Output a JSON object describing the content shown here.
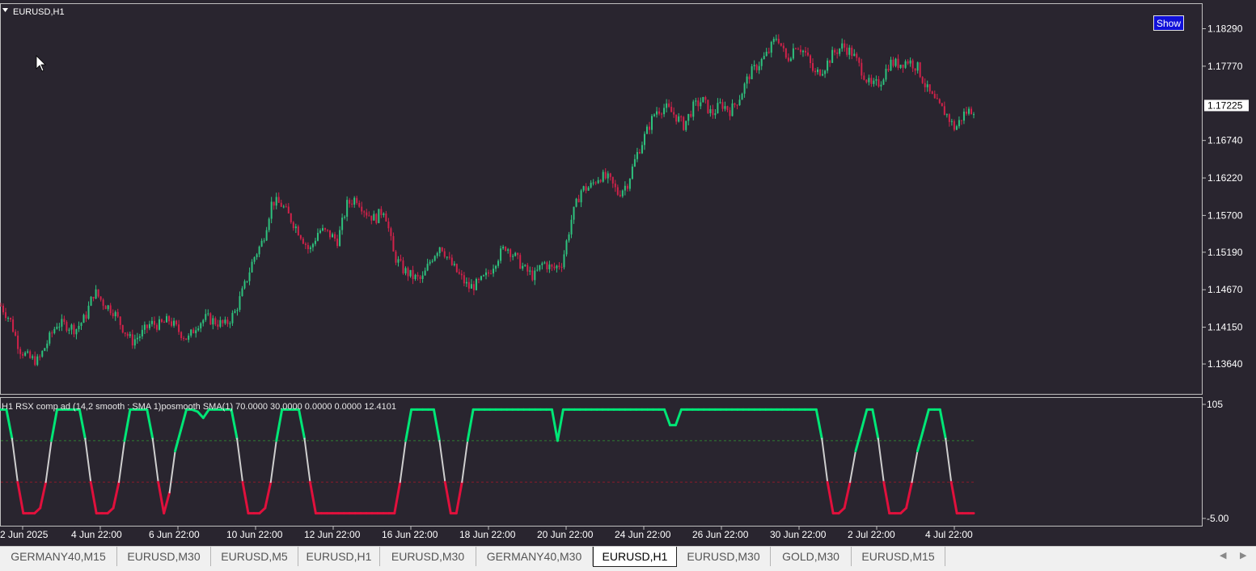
{
  "symbol_title": "EURUSD,H1",
  "indicator_title": "H1 RSX comp ad (14,2 smooth : SMA  1)posmooth SMA(1) 70.0000 30.0000 0.0000 0.0000 12.4101",
  "show_button": "Show",
  "current_price_label": "1.17225",
  "colors": {
    "background": "#29252f",
    "bull_candle": "#2ec27e",
    "bear_candle": "#d0224a",
    "indicator_up": "#00e676",
    "indicator_neutral": "#cfcfcf",
    "indicator_down": "#e0103c",
    "axis_text": "#ffffff"
  },
  "chart_data": [
    {
      "type": "candlestick",
      "title": "EURUSD,H1",
      "price_ticks": [
        "1.18290",
        "1.17770",
        "1.16740",
        "1.16220",
        "1.15700",
        "1.15190",
        "1.14670",
        "1.14150",
        "1.13640"
      ],
      "ylim": [
        1.1336,
        1.1852
      ],
      "time_labels": [
        "2 Jun 2025",
        "4 Jun 22:00",
        "6 Jun 22:00",
        "10 Jun 22:00",
        "12 Jun 22:00",
        "16 Jun 22:00",
        "18 Jun 22:00",
        "20 Jun 22:00",
        "24 Jun 22:00",
        "26 Jun 22:00",
        "30 Jun 22:00",
        "2 Jul 22:00",
        "4 Jul 22:00"
      ],
      "close_path": [
        1.1445,
        1.1425,
        1.1385,
        1.1372,
        1.1368,
        1.1395,
        1.142,
        1.1418,
        1.1412,
        1.1428,
        1.1465,
        1.1448,
        1.1438,
        1.1415,
        1.1395,
        1.1405,
        1.142,
        1.1418,
        1.1425,
        1.141,
        1.1398,
        1.142,
        1.1428,
        1.1422,
        1.1418,
        1.1435,
        1.147,
        1.151,
        1.1535,
        1.159,
        1.1585,
        1.1565,
        1.1545,
        1.152,
        1.155,
        1.1545,
        1.1535,
        1.1585,
        1.1595,
        1.1575,
        1.1565,
        1.158,
        1.1515,
        1.1495,
        1.1485,
        1.148,
        1.151,
        1.153,
        1.1505,
        1.1487,
        1.147,
        1.1475,
        1.1487,
        1.151,
        1.1528,
        1.1512,
        1.1495,
        1.1485,
        1.1505,
        1.1495,
        1.1505,
        1.1565,
        1.1605,
        1.161,
        1.1625,
        1.162,
        1.16,
        1.1615,
        1.1655,
        1.1685,
        1.1715,
        1.172,
        1.171,
        1.1695,
        1.172,
        1.173,
        1.171,
        1.1725,
        1.1715,
        1.1735,
        1.1765,
        1.178,
        1.1795,
        1.182,
        1.1785,
        1.1808,
        1.1795,
        1.1765,
        1.1775,
        1.1795,
        1.1805,
        1.1795,
        1.1772,
        1.1748,
        1.1755,
        1.1782,
        1.178,
        1.1785,
        1.1775,
        1.1745,
        1.1725,
        1.1712,
        1.169,
        1.1712,
        1.1718
      ],
      "last_price": 1.17225
    },
    {
      "type": "line",
      "title": "H1 RSX comp ad (14,2 smooth : SMA  1)posmooth SMA(1) 70.0000 30.0000 0.0000 0.0000 12.4101",
      "y_ticks": [
        "105",
        "-5.00"
      ],
      "ylim": [
        -5,
        105
      ],
      "levels": [
        70,
        30
      ],
      "values": [
        100,
        100,
        72,
        30,
        0,
        0,
        0,
        5,
        30,
        70,
        100,
        100,
        100,
        100,
        100,
        72,
        30,
        0,
        0,
        0,
        5,
        30,
        70,
        100,
        100,
        100,
        100,
        72,
        30,
        0,
        20,
        60,
        80,
        100,
        100,
        98,
        92,
        100,
        100,
        100,
        100,
        100,
        72,
        30,
        0,
        0,
        0,
        5,
        30,
        70,
        100,
        100,
        100,
        100,
        72,
        30,
        0,
        0,
        0,
        0,
        0,
        0,
        0,
        0,
        0,
        0,
        0,
        0,
        0,
        0,
        0,
        30,
        70,
        100,
        100,
        100,
        100,
        100,
        70,
        30,
        0,
        0,
        30,
        70,
        100,
        100,
        100,
        100,
        100,
        100,
        100,
        100,
        100,
        100,
        100,
        100,
        100,
        100,
        100,
        70,
        100,
        100,
        100,
        100,
        100,
        100,
        100,
        100,
        100,
        100,
        100,
        100,
        100,
        100,
        100,
        100,
        100,
        100,
        100,
        85,
        85,
        100,
        100,
        100,
        100,
        100,
        100,
        100,
        100,
        100,
        100,
        100,
        100,
        100,
        100,
        100,
        100,
        100,
        100,
        100,
        100,
        100,
        100,
        100,
        100,
        100,
        72,
        30,
        0,
        0,
        5,
        30,
        60,
        80,
        100,
        100,
        72,
        30,
        0,
        0,
        0,
        5,
        30,
        60,
        80,
        100,
        100,
        100,
        72,
        30,
        0,
        0,
        0,
        0
      ]
    }
  ],
  "tabs": [
    {
      "label": "GERMANY40,M15",
      "active": false
    },
    {
      "label": "EURUSD,M30",
      "active": false
    },
    {
      "label": "EURUSD,M5",
      "active": false
    },
    {
      "label": "EURUSD,H1",
      "active": false
    },
    {
      "label": "EURUSD,M30",
      "active": false
    },
    {
      "label": "GERMANY40,M30",
      "active": false
    },
    {
      "label": "EURUSD,H1",
      "active": true
    },
    {
      "label": "EURUSD,M30",
      "active": false
    },
    {
      "label": "GOLD,M30",
      "active": false
    },
    {
      "label": "EURUSD,M15",
      "active": false
    }
  ]
}
